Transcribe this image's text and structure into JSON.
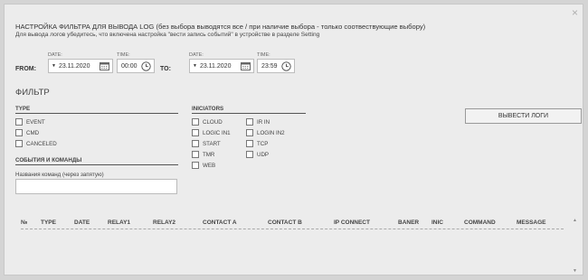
{
  "dialog": {
    "close_glyph": "×",
    "title": "НАСТРОЙКА ФИЛЬТРА ДЛЯ ВЫВОДА LOG (без выбора выводятся все / при наличие выбора - только соотвествующие выбору)",
    "subtitle": "Для вывода логов убедитесь, что включена настройка \"вести запись событий\" в устройстве в разделе Setting"
  },
  "range": {
    "date_label": "DATE:",
    "time_label": "TIME:",
    "from_label": "FROM:",
    "to_label": "TO:",
    "from_date": "23.11.2020",
    "from_time": "00:00",
    "to_date": "23.11.2020",
    "to_time": "23:59",
    "caret": "▼"
  },
  "filter": {
    "title": "ФИЛЬТР",
    "type_title": "TYPE",
    "type_items": [
      "EVENT",
      "CMD",
      "CANCELED"
    ],
    "indicators_title": "INICIATORS",
    "indicators_col1": [
      "CLOUD",
      "LOGIC IN1",
      "START",
      "TMR",
      "WEB"
    ],
    "indicators_col2": [
      "IR IN",
      "LOGIN IN2",
      "TCP",
      "UDP"
    ],
    "events_title": "СОБЫТИЯ И КОМАНДЫ",
    "commands_label": "Названия команд (через запятую)",
    "commands_value": "",
    "submit_label": "ВЫВЕСТИ ЛОГИ"
  },
  "table": {
    "columns": [
      "№",
      "TYPE",
      "DATE",
      "RELAY1",
      "RELAY2",
      "CONTACT A",
      "CONTACT B",
      "IP CONNECT",
      "BANER",
      "INIC",
      "COMMAND",
      "MESSAGE"
    ],
    "scroll_up": "▲",
    "scroll_down": "▼"
  }
}
